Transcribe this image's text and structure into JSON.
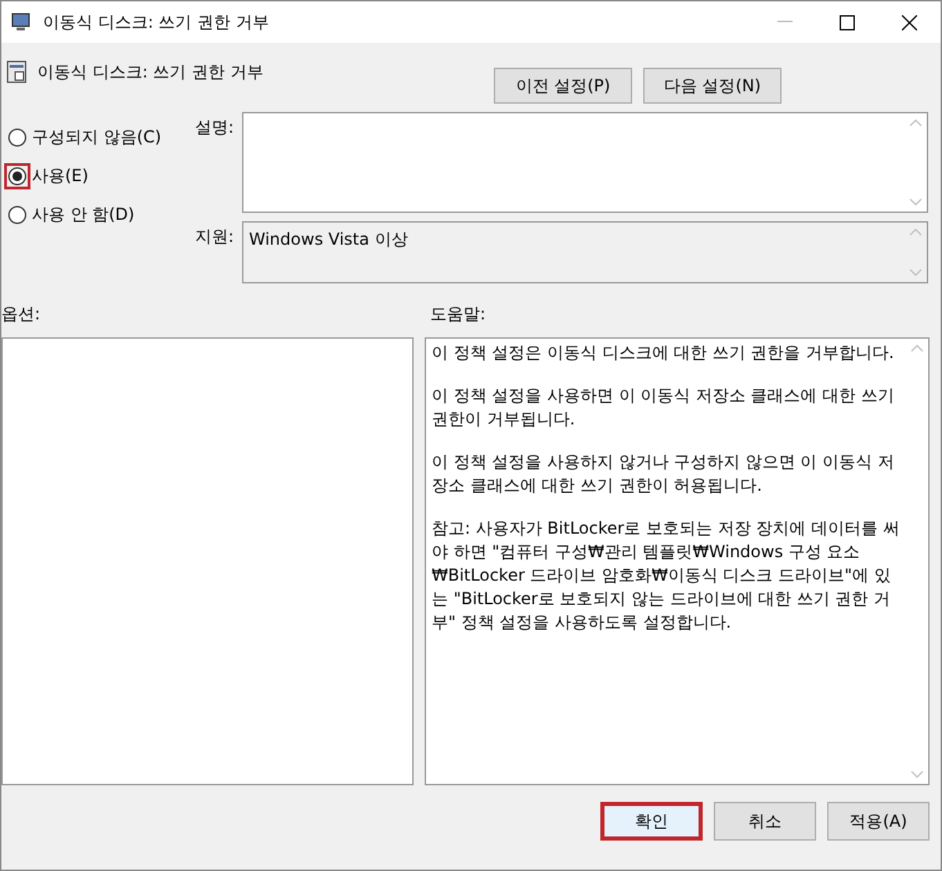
{
  "window": {
    "title": "이동식 디스크: 쓰기 권한 거부"
  },
  "header": {
    "title": "이동식 디스크: 쓰기 권한 거부",
    "buttons": [
      {
        "label": "이전 설정(P)"
      },
      {
        "label": "다음 설정(N)"
      }
    ]
  },
  "options": [
    {
      "label": "구성되지 않음(C)",
      "selected": false,
      "highlighted": false
    },
    {
      "label": "사용(E)",
      "selected": true,
      "highlighted": true
    },
    {
      "label": "사용 안 함(D)",
      "selected": false,
      "highlighted": false
    }
  ],
  "comment": {
    "label": "설명:"
  },
  "supported": {
    "label": "지원:",
    "value": "Windows Vista 이상"
  },
  "options_label": "옵션:",
  "help_label": "도움말:",
  "help_paragraphs": [
    "이 정책 설정은 이동식 디스크에 대한 쓰기 권한을 거부합니다.",
    "이 정책 설정을 사용하면 이 이동식 저장소 클래스에 대한 쓰기 권한이 거부됩니다.",
    "이 정책 설정을 사용하지 않거나 구성하지 않으면 이 이동식 저장소 클래스에 대한 쓰기 권한이 허용됩니다.",
    "참고: 사용자가 BitLocker로 보호되는 저장 장치에 데이터를 써야 하면 \"컴퓨터 구성₩관리 템플릿₩Windows 구성 요소₩BitLocker 드라이브 암호화₩이동식 디스크 드라이브\"에 있는 \"BitLocker로 보호되지 않는 드라이브에 대한 쓰기 권한 거부\" 정책 설정을 사용하도록 설정합니다."
  ],
  "footer_buttons": [
    {
      "label": "확인",
      "highlighted": true
    },
    {
      "label": "취소",
      "highlighted": false
    },
    {
      "label": "적용(A)",
      "highlighted": false
    }
  ]
}
